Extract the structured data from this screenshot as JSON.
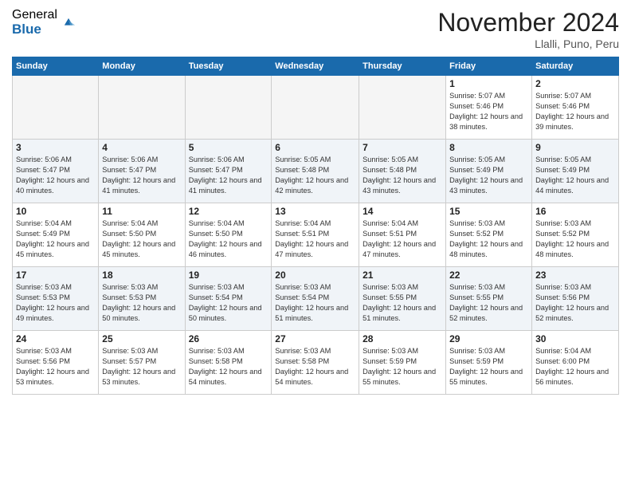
{
  "logo": {
    "general": "General",
    "blue": "Blue"
  },
  "title": "November 2024",
  "location": "Llalli, Puno, Peru",
  "weekdays": [
    "Sunday",
    "Monday",
    "Tuesday",
    "Wednesday",
    "Thursday",
    "Friday",
    "Saturday"
  ],
  "weeks": [
    [
      {
        "day": "",
        "info": ""
      },
      {
        "day": "",
        "info": ""
      },
      {
        "day": "",
        "info": ""
      },
      {
        "day": "",
        "info": ""
      },
      {
        "day": "",
        "info": ""
      },
      {
        "day": "1",
        "info": "Sunrise: 5:07 AM\nSunset: 5:46 PM\nDaylight: 12 hours\nand 38 minutes."
      },
      {
        "day": "2",
        "info": "Sunrise: 5:07 AM\nSunset: 5:46 PM\nDaylight: 12 hours\nand 39 minutes."
      }
    ],
    [
      {
        "day": "3",
        "info": "Sunrise: 5:06 AM\nSunset: 5:47 PM\nDaylight: 12 hours\nand 40 minutes."
      },
      {
        "day": "4",
        "info": "Sunrise: 5:06 AM\nSunset: 5:47 PM\nDaylight: 12 hours\nand 41 minutes."
      },
      {
        "day": "5",
        "info": "Sunrise: 5:06 AM\nSunset: 5:47 PM\nDaylight: 12 hours\nand 41 minutes."
      },
      {
        "day": "6",
        "info": "Sunrise: 5:05 AM\nSunset: 5:48 PM\nDaylight: 12 hours\nand 42 minutes."
      },
      {
        "day": "7",
        "info": "Sunrise: 5:05 AM\nSunset: 5:48 PM\nDaylight: 12 hours\nand 43 minutes."
      },
      {
        "day": "8",
        "info": "Sunrise: 5:05 AM\nSunset: 5:49 PM\nDaylight: 12 hours\nand 43 minutes."
      },
      {
        "day": "9",
        "info": "Sunrise: 5:05 AM\nSunset: 5:49 PM\nDaylight: 12 hours\nand 44 minutes."
      }
    ],
    [
      {
        "day": "10",
        "info": "Sunrise: 5:04 AM\nSunset: 5:49 PM\nDaylight: 12 hours\nand 45 minutes."
      },
      {
        "day": "11",
        "info": "Sunrise: 5:04 AM\nSunset: 5:50 PM\nDaylight: 12 hours\nand 45 minutes."
      },
      {
        "day": "12",
        "info": "Sunrise: 5:04 AM\nSunset: 5:50 PM\nDaylight: 12 hours\nand 46 minutes."
      },
      {
        "day": "13",
        "info": "Sunrise: 5:04 AM\nSunset: 5:51 PM\nDaylight: 12 hours\nand 47 minutes."
      },
      {
        "day": "14",
        "info": "Sunrise: 5:04 AM\nSunset: 5:51 PM\nDaylight: 12 hours\nand 47 minutes."
      },
      {
        "day": "15",
        "info": "Sunrise: 5:03 AM\nSunset: 5:52 PM\nDaylight: 12 hours\nand 48 minutes."
      },
      {
        "day": "16",
        "info": "Sunrise: 5:03 AM\nSunset: 5:52 PM\nDaylight: 12 hours\nand 48 minutes."
      }
    ],
    [
      {
        "day": "17",
        "info": "Sunrise: 5:03 AM\nSunset: 5:53 PM\nDaylight: 12 hours\nand 49 minutes."
      },
      {
        "day": "18",
        "info": "Sunrise: 5:03 AM\nSunset: 5:53 PM\nDaylight: 12 hours\nand 50 minutes."
      },
      {
        "day": "19",
        "info": "Sunrise: 5:03 AM\nSunset: 5:54 PM\nDaylight: 12 hours\nand 50 minutes."
      },
      {
        "day": "20",
        "info": "Sunrise: 5:03 AM\nSunset: 5:54 PM\nDaylight: 12 hours\nand 51 minutes."
      },
      {
        "day": "21",
        "info": "Sunrise: 5:03 AM\nSunset: 5:55 PM\nDaylight: 12 hours\nand 51 minutes."
      },
      {
        "day": "22",
        "info": "Sunrise: 5:03 AM\nSunset: 5:55 PM\nDaylight: 12 hours\nand 52 minutes."
      },
      {
        "day": "23",
        "info": "Sunrise: 5:03 AM\nSunset: 5:56 PM\nDaylight: 12 hours\nand 52 minutes."
      }
    ],
    [
      {
        "day": "24",
        "info": "Sunrise: 5:03 AM\nSunset: 5:56 PM\nDaylight: 12 hours\nand 53 minutes."
      },
      {
        "day": "25",
        "info": "Sunrise: 5:03 AM\nSunset: 5:57 PM\nDaylight: 12 hours\nand 53 minutes."
      },
      {
        "day": "26",
        "info": "Sunrise: 5:03 AM\nSunset: 5:58 PM\nDaylight: 12 hours\nand 54 minutes."
      },
      {
        "day": "27",
        "info": "Sunrise: 5:03 AM\nSunset: 5:58 PM\nDaylight: 12 hours\nand 54 minutes."
      },
      {
        "day": "28",
        "info": "Sunrise: 5:03 AM\nSunset: 5:59 PM\nDaylight: 12 hours\nand 55 minutes."
      },
      {
        "day": "29",
        "info": "Sunrise: 5:03 AM\nSunset: 5:59 PM\nDaylight: 12 hours\nand 55 minutes."
      },
      {
        "day": "30",
        "info": "Sunrise: 5:04 AM\nSunset: 6:00 PM\nDaylight: 12 hours\nand 56 minutes."
      }
    ]
  ],
  "colors": {
    "header_bg": "#1a6aac",
    "accent": "#1a6aac"
  }
}
